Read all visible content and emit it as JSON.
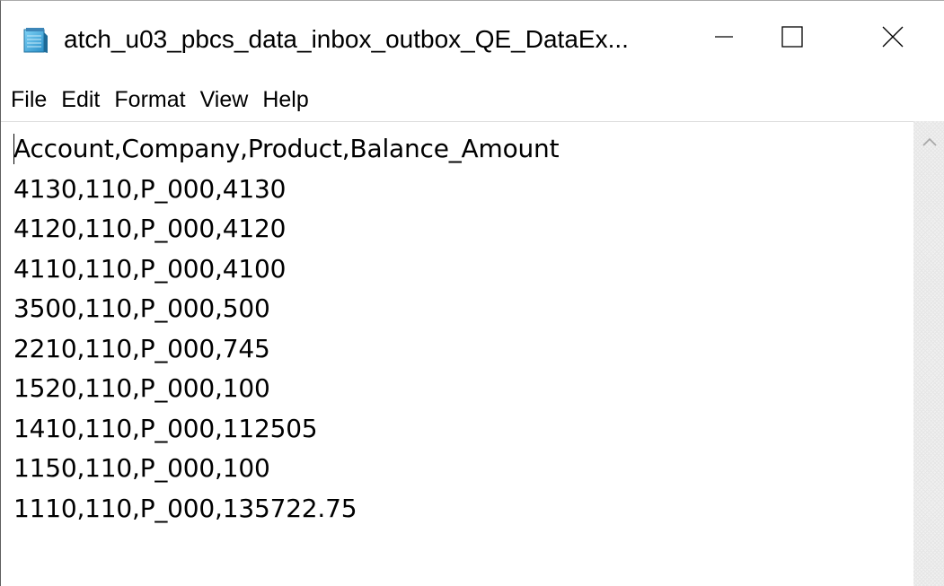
{
  "window": {
    "title": "atch_u03_pbcs_data_inbox_outbox_QE_DataEx...",
    "app_icon": "notepad-icon",
    "controls": {
      "minimize_icon": "minimize-icon",
      "maximize_icon": "maximize-icon",
      "close_icon": "close-icon"
    }
  },
  "menubar": {
    "items": [
      {
        "label": "File"
      },
      {
        "label": "Edit"
      },
      {
        "label": "Format"
      },
      {
        "label": "View"
      },
      {
        "label": "Help"
      }
    ]
  },
  "editor": {
    "lines": [
      "Account,Company,Product,Balance_Amount",
      "4130,110,P_000,4130",
      "4120,110,P_000,4120",
      "4110,110,P_000,4100",
      "3500,110,P_000,500",
      "2210,110,P_000,745",
      "1520,110,P_000,100",
      "1410,110,P_000,112505",
      "1150,110,P_000,100",
      "1110,110,P_000,135722.75"
    ]
  },
  "scrollbar": {
    "up_icon": "chevron-up-icon"
  }
}
